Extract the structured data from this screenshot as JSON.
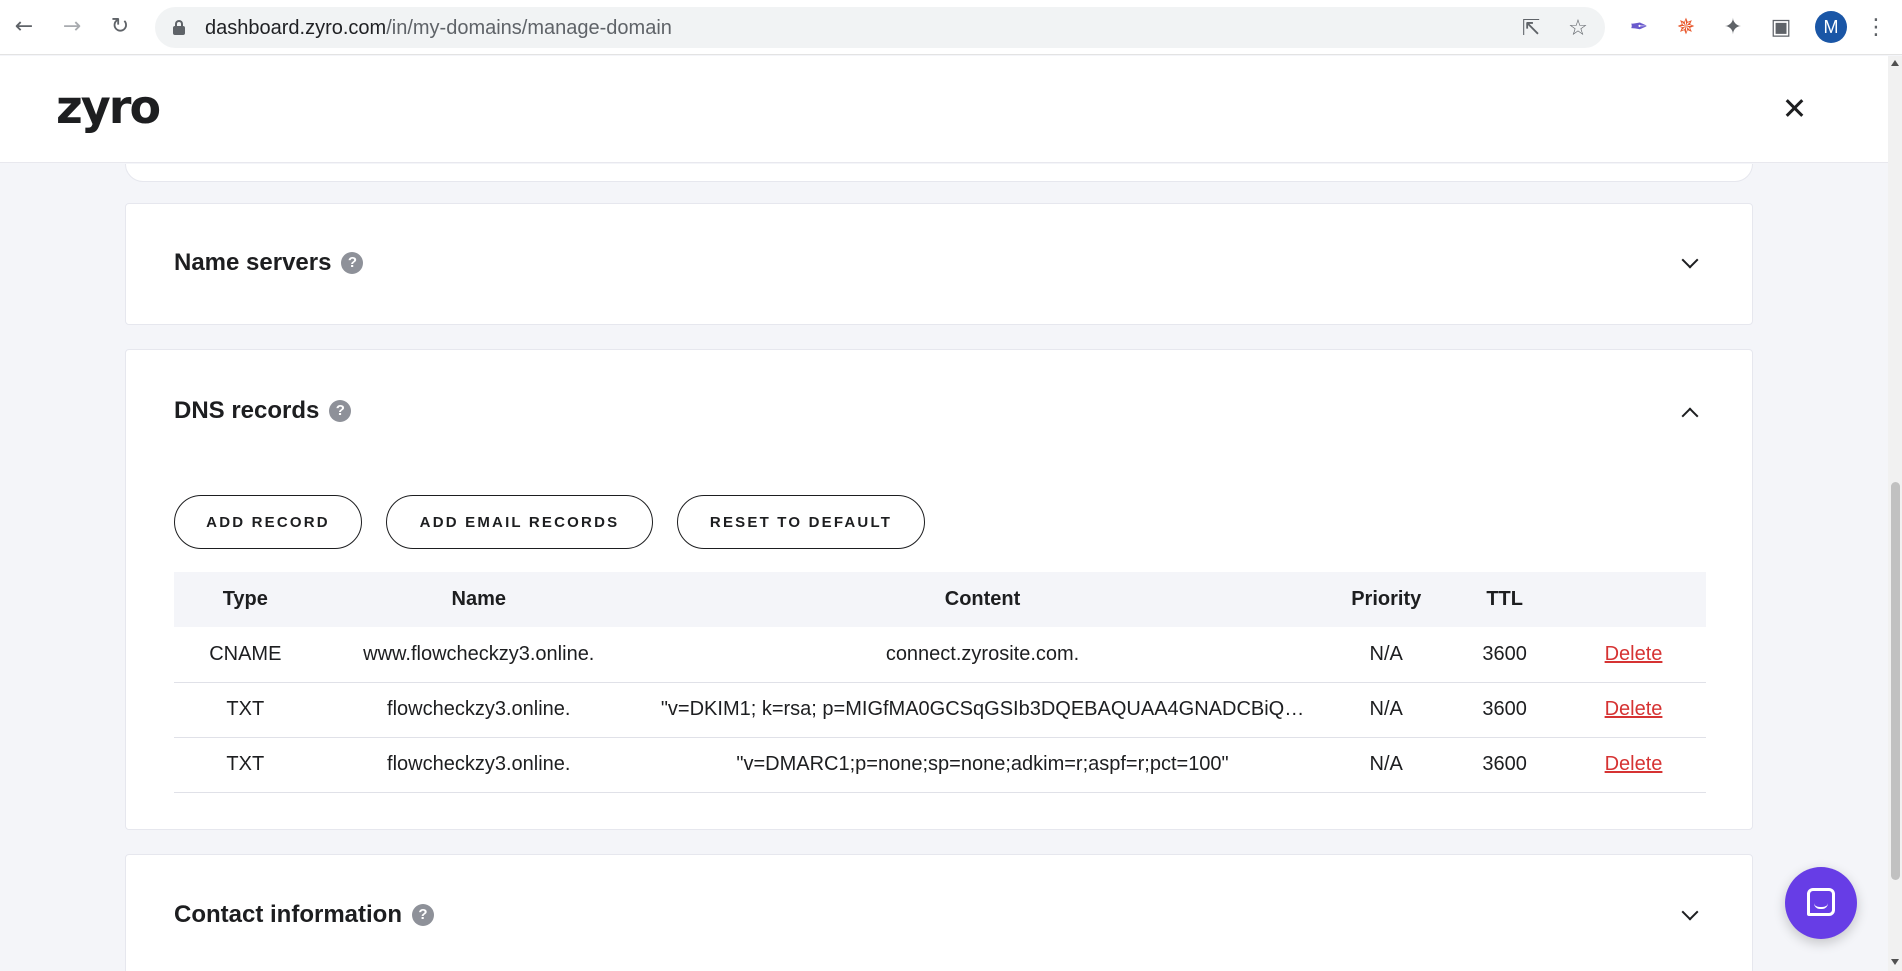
{
  "browser": {
    "url_host": "dashboard.zyro.com",
    "url_path": "/in/my-domains/manage-domain",
    "back_icon": "←",
    "forward_icon": "→",
    "reload_icon": "↻",
    "share_icon": "⇱",
    "star_icon": "☆",
    "ext1_icon": "✒",
    "ext2_icon": "✵",
    "puzzle_icon": "✦",
    "sidepanel_icon": "▣",
    "menu_icon": "⋮",
    "avatar_letter": "M"
  },
  "app": {
    "logo": "zyro"
  },
  "sections": {
    "name_servers": {
      "title": "Name servers",
      "help": "?"
    },
    "dns_records": {
      "title": "DNS records",
      "help": "?"
    },
    "contact_information": {
      "title": "Contact information",
      "help": "?"
    }
  },
  "dns": {
    "buttons": {
      "add_record": "ADD RECORD",
      "add_email_records": "ADD EMAIL RECORDS",
      "reset_to_default": "RESET TO DEFAULT"
    },
    "columns": {
      "type": "Type",
      "name": "Name",
      "content": "Content",
      "priority": "Priority",
      "ttl": "TTL"
    },
    "rows": [
      {
        "type": "CNAME",
        "name": "www.flowcheckzy3.online.",
        "content": "connect.zyrosite.com.",
        "priority": "N/A",
        "ttl": "3600",
        "action": "Delete"
      },
      {
        "type": "TXT",
        "name": "flowcheckzy3.online.",
        "content": "\"v=DKIM1; k=rsa; p=MIGfMA0GCSqGSIb3DQEBAQUAA4GNADCBiQ…",
        "priority": "N/A",
        "ttl": "3600",
        "action": "Delete"
      },
      {
        "type": "TXT",
        "name": "flowcheckzy3.online.",
        "content": "\"v=DMARC1;p=none;sp=none;adkim=r;aspf=r;pct=100\"",
        "priority": "N/A",
        "ttl": "3600",
        "action": "Delete"
      }
    ]
  },
  "colors": {
    "accent": "#673de6",
    "delete": "#d63333",
    "background": "#f4f5f9"
  }
}
